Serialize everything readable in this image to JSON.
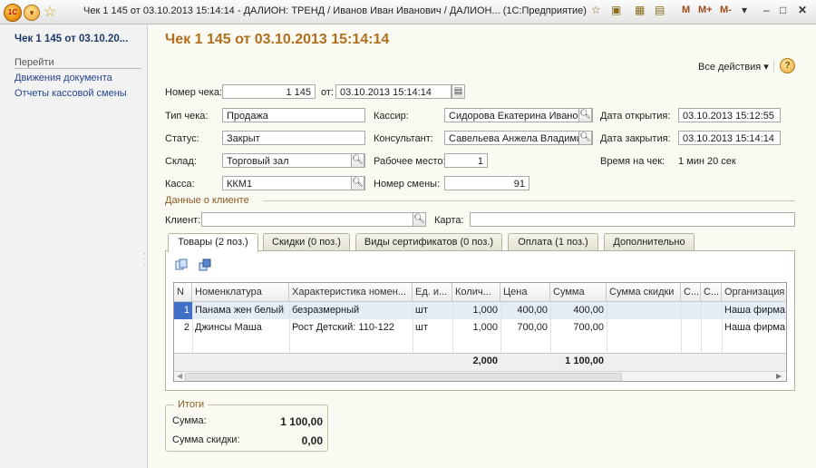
{
  "titlebar": {
    "title": "Чек 1 145 от 03.10.2013 15:14:14 - ДАЛИОН: ТРЕНД / Иванов Иван Иванович / ДАЛИОН...  (1С:Предприятие)",
    "m_labels": [
      "M",
      "M+",
      "M-"
    ],
    "icons": [
      "1c-logo-icon",
      "menu-arrow-icon",
      "favorites-star-icon",
      "add-favorite-icon",
      "history-icon",
      "calculator-icon",
      "calendar-icon",
      "minimize-icon",
      "maximize-icon",
      "close-icon"
    ]
  },
  "sidebar": {
    "title": "Чек 1 145 от 03.10.20...",
    "section": "Перейти",
    "links": [
      "Движения документа",
      "Отчеты кассовой смены"
    ]
  },
  "doc": {
    "title": "Чек 1 145 от 03.10.2013 15:14:14",
    "all_actions": "Все действия",
    "help": "?"
  },
  "header_fields": {
    "receipt_no_label": "Номер чека:",
    "receipt_no": "1 145",
    "from_label": "от:",
    "from_date": "03.10.2013 15:14:14",
    "type_label": "Тип чека:",
    "type": "Продажа",
    "status_label": "Статус:",
    "status": "Закрыт",
    "warehouse_label": "Склад:",
    "warehouse": "Торговый зал",
    "register_label": "Касса:",
    "register": "ККМ1",
    "cashier_label": "Кассир:",
    "cashier": "Сидорова Екатерина Иванов",
    "consultant_label": "Консультант:",
    "consultant": "Савельева Анжела Владими",
    "workplace_label": "Рабочее место:",
    "workplace": "1",
    "shift_label": "Номер смены:",
    "shift": "91",
    "opened_label": "Дата открытия:",
    "opened": "03.10.2013 15:12:55",
    "closed_label": "Дата закрытия:",
    "closed": "03.10.2013 15:14:14",
    "time_label": "Время на чек:",
    "time": "1 мин 20 сек"
  },
  "client": {
    "section": "Данные о клиенте",
    "client_label": "Клиент:",
    "client": "",
    "card_label": "Карта:",
    "card": ""
  },
  "tabs": [
    "Товары (2 поз.)",
    "Скидки (0 поз.)",
    "Виды сертификатов (0 поз.)",
    "Оплата (1 поз.)",
    "Дополнительно"
  ],
  "table": {
    "columns": [
      "N",
      "Номенклатура",
      "Характеристика номен...",
      "Ед. и...",
      "Колич...",
      "Цена",
      "Сумма",
      "Сумма скидки",
      "С...",
      "С...",
      "Организация"
    ],
    "rows": [
      [
        "1",
        "Панама жен белый",
        "безразмерный",
        "шт",
        "1,000",
        "400,00",
        "400,00",
        "",
        "",
        "",
        "Наша фирма"
      ],
      [
        "2",
        "Джинсы Маша",
        "Рост Детский: 110-122",
        "шт",
        "1,000",
        "700,00",
        "700,00",
        "",
        "",
        "",
        "Наша фирма"
      ]
    ],
    "totals": {
      "quantity": "2,000",
      "sum": "1 100,00"
    }
  },
  "summary": {
    "title": "Итоги",
    "sum_label": "Сумма:",
    "sum": "1 100,00",
    "discount_label": "Сумма скидки:",
    "discount": "0,00"
  }
}
